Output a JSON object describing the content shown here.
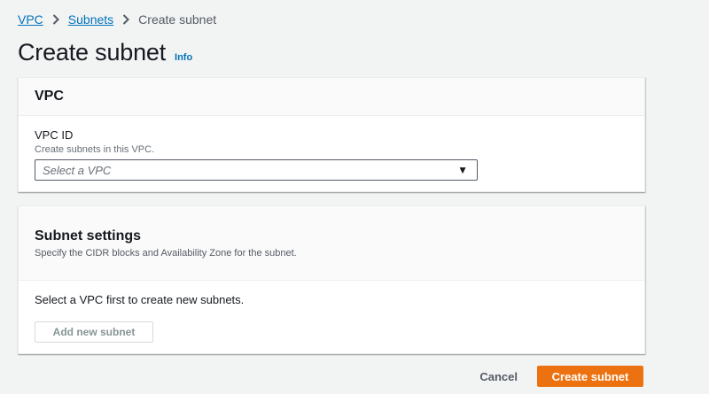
{
  "breadcrumb": {
    "items": [
      "VPC",
      "Subnets"
    ],
    "current": "Create subnet"
  },
  "page": {
    "title": "Create subnet",
    "info_label": "Info"
  },
  "vpc_section": {
    "title": "VPC",
    "field_label": "VPC ID",
    "field_description": "Create subnets in this VPC.",
    "select_placeholder": "Select a VPC"
  },
  "subnet_section": {
    "title": "Subnet settings",
    "description": "Specify the CIDR blocks and Availability Zone for the subnet.",
    "empty_message": "Select a VPC first to create new subnets.",
    "add_button_label": "Add new subnet",
    "add_button_enabled": false
  },
  "actions": {
    "cancel_label": "Cancel",
    "submit_label": "Create subnet"
  },
  "colors": {
    "link": "#0073bb",
    "primary_button": "#ec7211",
    "background": "#f2f3f3"
  },
  "icons": {
    "breadcrumb_separator": "chevron-right-icon",
    "select_caret": "caret-down-icon"
  }
}
